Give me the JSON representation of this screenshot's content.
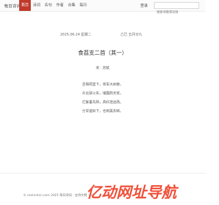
{
  "header": {
    "logo": "每日诗词",
    "nav": [
      "首页",
      "诗词",
      "名句",
      "作者",
      "合集",
      "每日"
    ],
    "login": "登录",
    "search_placeholder": "搜索诗歌或词语"
  },
  "date": {
    "gregorian": "2025.06.24 星期二",
    "lunar": "乙巳 五月廿九"
  },
  "poem": {
    "title": "食荔支二首（其一）",
    "author": "宋 · 苏轼",
    "lines": [
      "丞相祠堂下，将军大树旁。",
      "炎云骈火实，瑞露酌天浆。",
      "烂紫垂先熟，高红挂远扬。",
      "分甘遍铃下，也到黑衣郎。"
    ]
  },
  "footer": {
    "copyright": "© meirishici.com 2025 每日诗词 · 古诗文网 · All",
    "brand_text": "亿动网址导航",
    "brand_color": "#f0503a"
  }
}
